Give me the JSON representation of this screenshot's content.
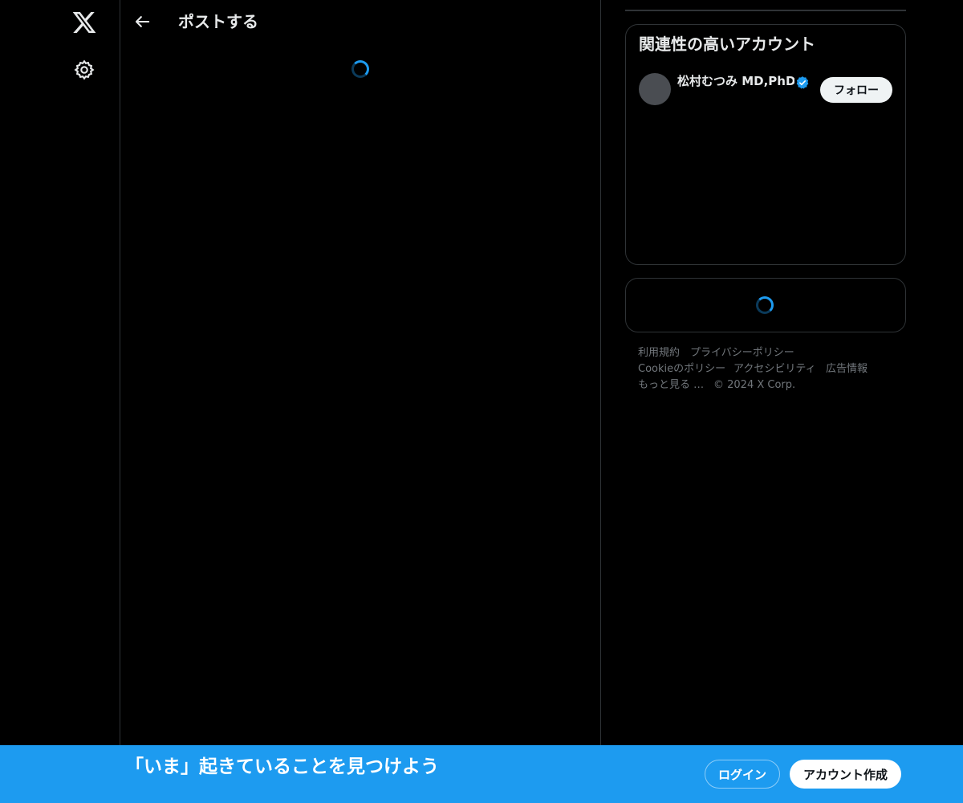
{
  "nav": {
    "logo_icon": "x-logo-icon",
    "settings_icon": "gear-icon"
  },
  "header": {
    "back_icon": "arrow-left-icon",
    "title": "ポストする"
  },
  "sidebar": {
    "relevant_accounts": {
      "title": "関連性の高いアカウント",
      "accounts": [
        {
          "name": "松村むつみ MD,PhD@",
          "verified": true,
          "follow_label": "フォロー"
        }
      ]
    },
    "footer": {
      "links": [
        "利用規約",
        "プライバシーポリシー",
        "Cookieのポリシー",
        "アクセシビリティ",
        "広告情報",
        "もっと見る …",
        "© 2024 X Corp."
      ]
    }
  },
  "bottom_bar": {
    "tagline": "「いま」起きていることを見つけよう",
    "login_label": "ログイン",
    "signup_label": "アカウント作成"
  },
  "colors": {
    "background": "#000000",
    "accent": "#1d9bf0",
    "border": "#2f3336",
    "muted_text": "#71767b"
  }
}
